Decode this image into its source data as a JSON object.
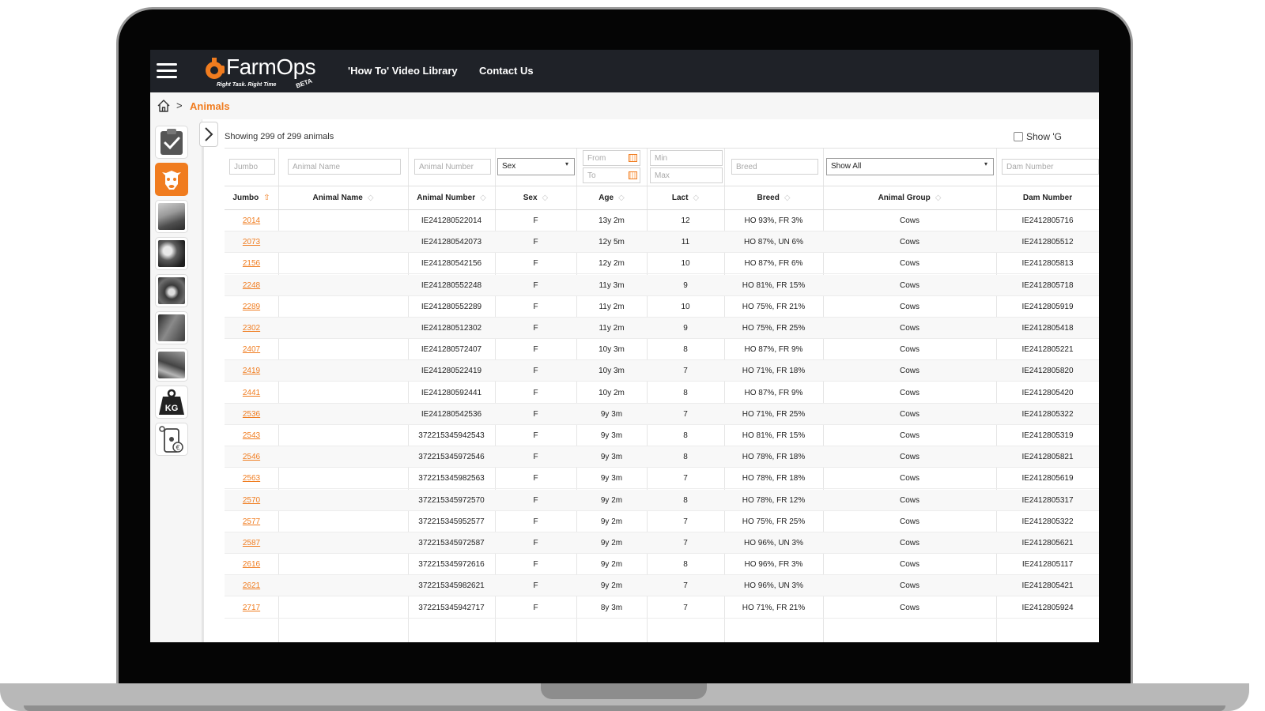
{
  "app": {
    "logo_text": "FarmOps",
    "logo_tagline": "Right Task. Right Time",
    "logo_badge": "BETA",
    "brand_color": "#f07c1f",
    "topbar_color": "#1f2228"
  },
  "nav": {
    "video_library": "'How To' Video Library",
    "contact": "Contact Us"
  },
  "breadcrumb": {
    "separator": ">",
    "current": "Animals"
  },
  "sidebar": {
    "tiles": [
      {
        "name": "tasks",
        "icon": "clipboard-check-icon"
      },
      {
        "name": "animals",
        "icon": "cow-icon",
        "active": true
      },
      {
        "name": "grazing",
        "icon": "photo-thumbnail"
      },
      {
        "name": "breeding",
        "icon": "photo-thumbnail"
      },
      {
        "name": "calves",
        "icon": "photo-thumbnail"
      },
      {
        "name": "health",
        "icon": "photo-thumbnail"
      },
      {
        "name": "milking",
        "icon": "photo-thumbnail"
      },
      {
        "name": "weights",
        "icon": "kg-weight-icon",
        "label": "KG"
      },
      {
        "name": "costs",
        "icon": "phone-euro-icon"
      }
    ]
  },
  "summary": {
    "showing": "Showing 299 of 299 animals",
    "show_groups_label": "Show 'G"
  },
  "filters": {
    "jumbo_placeholder": "Jumbo",
    "animal_name_placeholder": "Animal Name",
    "animal_number_placeholder": "Animal Number",
    "sex_value": "Sex",
    "age_from": "From",
    "age_to": "To",
    "lact_min": "Min",
    "lact_max": "Max",
    "breed_placeholder": "Breed",
    "group_value": "Show All",
    "dam_number_placeholder": "Dam Number"
  },
  "columns": {
    "jumbo": "Jumbo",
    "animal_name": "Animal Name",
    "animal_number": "Animal Number",
    "sex": "Sex",
    "age": "Age",
    "lact": "Lact",
    "breed": "Breed",
    "animal_group": "Animal Group",
    "dam_number": "Dam Number"
  },
  "rows": [
    {
      "jumbo": "2014",
      "name": "",
      "number": "IE241280522014",
      "sex": "F",
      "age": "13y 2m",
      "lact": "12",
      "breed": "HO 93%, FR 3%",
      "group": "Cows",
      "dam": "IE2412805716"
    },
    {
      "jumbo": "2073",
      "name": "",
      "number": "IE241280542073",
      "sex": "F",
      "age": "12y 5m",
      "lact": "11",
      "breed": "HO 87%, UN 6%",
      "group": "Cows",
      "dam": "IE2412805512"
    },
    {
      "jumbo": "2156",
      "name": "",
      "number": "IE241280542156",
      "sex": "F",
      "age": "12y 2m",
      "lact": "10",
      "breed": "HO 87%, FR 6%",
      "group": "Cows",
      "dam": "IE2412805813"
    },
    {
      "jumbo": "2248",
      "name": "",
      "number": "IE241280552248",
      "sex": "F",
      "age": "11y 3m",
      "lact": "9",
      "breed": "HO 81%, FR 15%",
      "group": "Cows",
      "dam": "IE2412805718"
    },
    {
      "jumbo": "2289",
      "name": "",
      "number": "IE241280552289",
      "sex": "F",
      "age": "11y 2m",
      "lact": "10",
      "breed": "HO 75%, FR 21%",
      "group": "Cows",
      "dam": "IE2412805919"
    },
    {
      "jumbo": "2302",
      "name": "",
      "number": "IE241280512302",
      "sex": "F",
      "age": "11y 2m",
      "lact": "9",
      "breed": "HO 75%, FR 25%",
      "group": "Cows",
      "dam": "IE2412805418"
    },
    {
      "jumbo": "2407",
      "name": "",
      "number": "IE241280572407",
      "sex": "F",
      "age": "10y 3m",
      "lact": "8",
      "breed": "HO 87%, FR 9%",
      "group": "Cows",
      "dam": "IE2412805221"
    },
    {
      "jumbo": "2419",
      "name": "",
      "number": "IE241280522419",
      "sex": "F",
      "age": "10y 3m",
      "lact": "7",
      "breed": "HO 71%, FR 18%",
      "group": "Cows",
      "dam": "IE2412805820"
    },
    {
      "jumbo": "2441",
      "name": "",
      "number": "IE241280592441",
      "sex": "F",
      "age": "10y 2m",
      "lact": "8",
      "breed": "HO 87%, FR 9%",
      "group": "Cows",
      "dam": "IE2412805420"
    },
    {
      "jumbo": "2536",
      "name": "",
      "number": "IE241280542536",
      "sex": "F",
      "age": "9y 3m",
      "lact": "7",
      "breed": "HO 71%, FR 25%",
      "group": "Cows",
      "dam": "IE2412805322"
    },
    {
      "jumbo": "2543",
      "name": "",
      "number": "372215345942543",
      "sex": "F",
      "age": "9y 3m",
      "lact": "8",
      "breed": "HO 81%, FR 15%",
      "group": "Cows",
      "dam": "IE2412805319"
    },
    {
      "jumbo": "2546",
      "name": "",
      "number": "372215345972546",
      "sex": "F",
      "age": "9y 3m",
      "lact": "8",
      "breed": "HO 78%, FR 18%",
      "group": "Cows",
      "dam": "IE2412805821"
    },
    {
      "jumbo": "2563",
      "name": "",
      "number": "372215345982563",
      "sex": "F",
      "age": "9y 3m",
      "lact": "7",
      "breed": "HO 78%, FR 18%",
      "group": "Cows",
      "dam": "IE2412805619"
    },
    {
      "jumbo": "2570",
      "name": "",
      "number": "372215345972570",
      "sex": "F",
      "age": "9y 2m",
      "lact": "8",
      "breed": "HO 78%, FR 12%",
      "group": "Cows",
      "dam": "IE2412805317"
    },
    {
      "jumbo": "2577",
      "name": "",
      "number": "372215345952577",
      "sex": "F",
      "age": "9y 2m",
      "lact": "7",
      "breed": "HO 75%, FR 25%",
      "group": "Cows",
      "dam": "IE2412805322"
    },
    {
      "jumbo": "2587",
      "name": "",
      "number": "372215345972587",
      "sex": "F",
      "age": "9y 2m",
      "lact": "7",
      "breed": "HO 96%, UN 3%",
      "group": "Cows",
      "dam": "IE2412805621"
    },
    {
      "jumbo": "2616",
      "name": "",
      "number": "372215345972616",
      "sex": "F",
      "age": "9y 2m",
      "lact": "8",
      "breed": "HO 96%, FR 3%",
      "group": "Cows",
      "dam": "IE2412805117"
    },
    {
      "jumbo": "2621",
      "name": "",
      "number": "372215345982621",
      "sex": "F",
      "age": "9y 2m",
      "lact": "7",
      "breed": "HO 96%, UN 3%",
      "group": "Cows",
      "dam": "IE2412805421"
    },
    {
      "jumbo": "2717",
      "name": "",
      "number": "372215345942717",
      "sex": "F",
      "age": "8y 3m",
      "lact": "7",
      "breed": "HO 71%, FR 21%",
      "group": "Cows",
      "dam": "IE2412805924"
    }
  ]
}
